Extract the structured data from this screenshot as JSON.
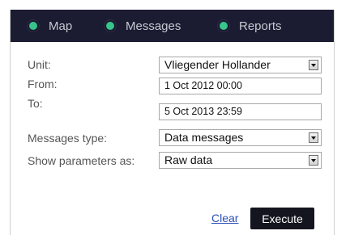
{
  "tabs": [
    {
      "label": "Map",
      "icon": "green-dot-icon"
    },
    {
      "label": "Messages",
      "icon": "green-dot-icon"
    },
    {
      "label": "Reports",
      "icon": "green-dot-icon"
    }
  ],
  "colors": {
    "tabbar_bg": "#1b1b31",
    "tab_dot": "#37c58a",
    "link": "#2b4fb8",
    "execute_bg": "#15151f"
  },
  "form": {
    "unit": {
      "label": "Unit:",
      "value": "Vliegender Hollander"
    },
    "from": {
      "label": "From:",
      "value": "1 Oct 2012 00:00"
    },
    "to": {
      "label": "To:",
      "value": "5 Oct 2013 23:59"
    },
    "messages_type": {
      "label": "Messages type:",
      "value": "Data messages"
    },
    "show_parameters": {
      "label": "Show parameters as:",
      "value": "Raw data"
    }
  },
  "actions": {
    "clear": "Clear",
    "execute": "Execute"
  }
}
